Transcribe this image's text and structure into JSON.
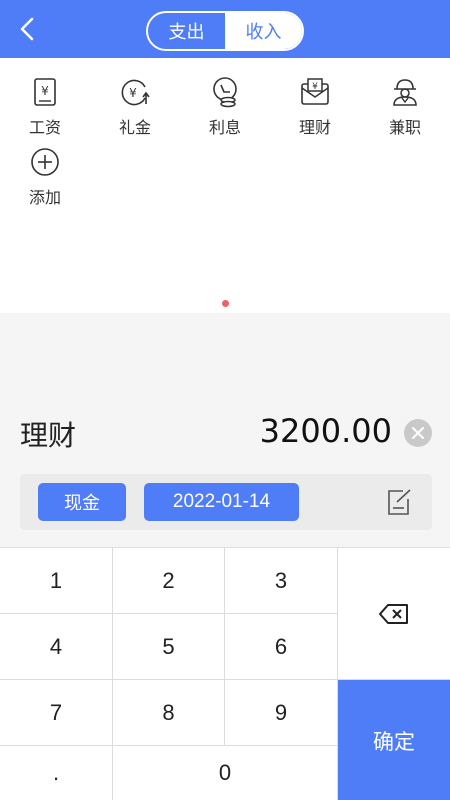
{
  "header": {
    "tabs": [
      {
        "label": "支出",
        "active": false
      },
      {
        "label": "收入",
        "active": true
      }
    ],
    "accent_color": "#4f7cf7"
  },
  "categories": [
    {
      "label": "工资",
      "icon": "salary-icon"
    },
    {
      "label": "礼金",
      "icon": "gift-money-icon"
    },
    {
      "label": "利息",
      "icon": "interest-icon"
    },
    {
      "label": "理财",
      "icon": "wealth-management-icon"
    },
    {
      "label": "兼职",
      "icon": "part-time-icon"
    },
    {
      "label": "添加",
      "icon": "add-circle-icon"
    }
  ],
  "entry": {
    "category": "理财",
    "amount": "3200.00"
  },
  "toolbar": {
    "account": "现金",
    "date": "2022-01-14"
  },
  "keypad": {
    "keys": [
      "1",
      "2",
      "3",
      "4",
      "5",
      "6",
      "7",
      "8",
      "9",
      ".",
      "0"
    ],
    "confirm": "确定"
  }
}
